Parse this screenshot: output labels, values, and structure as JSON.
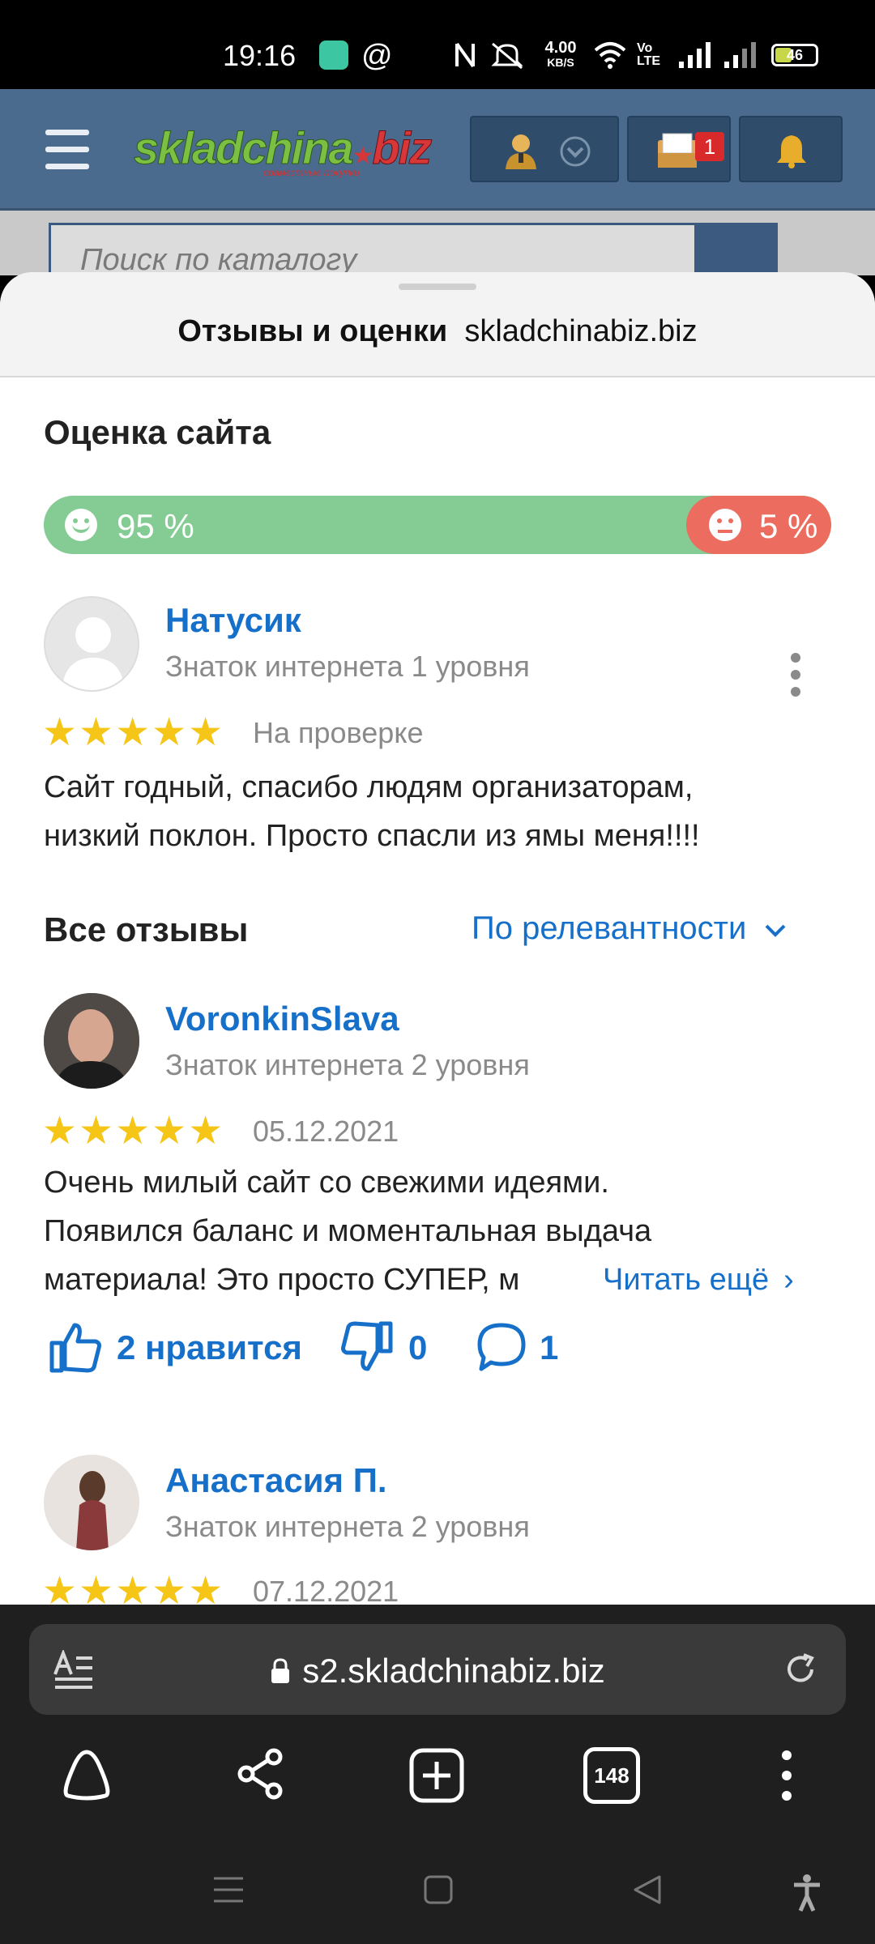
{
  "status_bar": {
    "time": "19:16",
    "net_speed_value": "4.00",
    "net_speed_unit": "KB/S",
    "volte": "Vo LTE",
    "battery": "46"
  },
  "site": {
    "logo_left": "skladchina",
    "logo_right": "biz",
    "logo_tagline": "совместные покупки",
    "messages_badge": "1",
    "search_placeholder": "Поиск по каталогу"
  },
  "sheet": {
    "title_bold": "Отзывы и оценки",
    "title_domain": "skladchinabiz.biz",
    "rating_heading": "Оценка сайта",
    "positive_percent": "95 %",
    "negative_percent": "5 %",
    "positive_fraction": 0.95,
    "my_review": {
      "author": "Натусик",
      "level": "Знаток интернета 1 уровня",
      "stars": 5,
      "status": "На проверке",
      "text_line1": "Сайт годный, спасибо людям организаторам,",
      "text_line2": "низкий поклон. Просто спасли из ямы меня!!!!"
    },
    "all_reviews_heading": "Все отзывы",
    "sort_label": "По релевантности",
    "reviews": [
      {
        "author": "VoronkinSlava",
        "level": "Знаток интернета 2 уровня",
        "stars": 5,
        "date": "05.12.2021",
        "line1": "Очень милый сайт со свежими идеями.",
        "line2": "Появился баланс и моментальная выдача",
        "line3": "материала! Это просто СУПЕР, м",
        "read_more": "Читать ещё",
        "likes": "2 нравится",
        "dislikes": "0",
        "comments": "1"
      },
      {
        "author": "Анастасия П.",
        "level": "Знаток интернета 2 уровня",
        "stars": 5,
        "date": "07.12.2021"
      }
    ]
  },
  "browser": {
    "url": "s2.skladchinabiz.biz",
    "tabs_count": "148"
  },
  "colors": {
    "positive": "#84cc93",
    "negative": "#ec6d5f",
    "link": "#1670c9",
    "star": "#f5c518"
  }
}
